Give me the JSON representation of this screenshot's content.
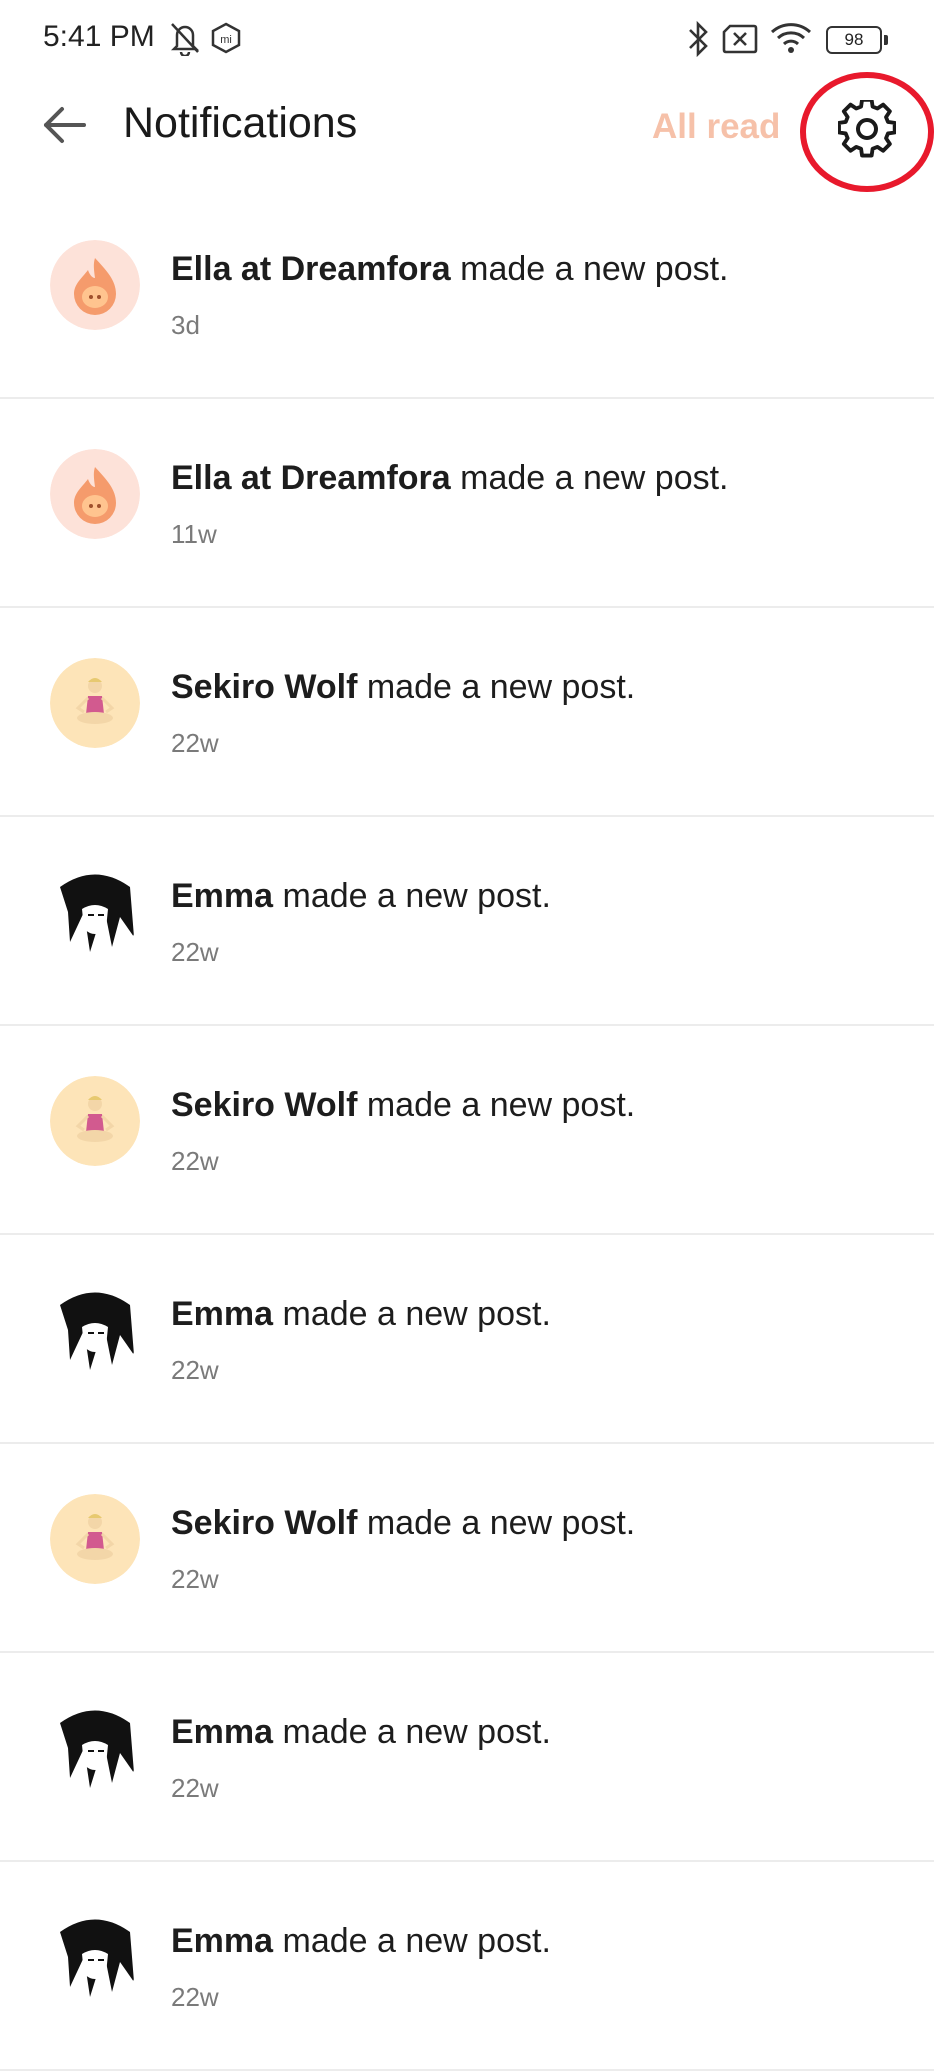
{
  "status_bar": {
    "time": "5:41 PM",
    "battery": "98",
    "icons": [
      "bell-off-icon",
      "mi-icon",
      "bluetooth-icon",
      "sim-x-icon",
      "wifi-icon",
      "battery-icon"
    ]
  },
  "header": {
    "title": "Notifications",
    "all_read_label": "All read",
    "back_icon": "back-arrow-icon",
    "settings_icon": "gear-icon"
  },
  "colors": {
    "accent": "#f6c1a9",
    "highlight": "#e8192c"
  },
  "notifications": [
    {
      "name": "Ella at Dreamfora",
      "action": " made a new post.",
      "time": "3d",
      "avatar": "flame"
    },
    {
      "name": "Ella at Dreamfora",
      "action": " made a new post.",
      "time": "11w",
      "avatar": "flame"
    },
    {
      "name": "Sekiro Wolf",
      "action": " made a new post.",
      "time": "22w",
      "avatar": "meditate"
    },
    {
      "name": "Emma",
      "action": " made a new post.",
      "time": "22w",
      "avatar": "manga"
    },
    {
      "name": "Sekiro Wolf",
      "action": " made a new post.",
      "time": "22w",
      "avatar": "meditate"
    },
    {
      "name": "Emma",
      "action": " made a new post.",
      "time": "22w",
      "avatar": "manga"
    },
    {
      "name": "Sekiro Wolf",
      "action": " made a new post.",
      "time": "22w",
      "avatar": "meditate"
    },
    {
      "name": "Emma",
      "action": " made a new post.",
      "time": "22w",
      "avatar": "manga"
    },
    {
      "name": "Emma",
      "action": " made a new post.",
      "time": "22w",
      "avatar": "manga"
    }
  ]
}
